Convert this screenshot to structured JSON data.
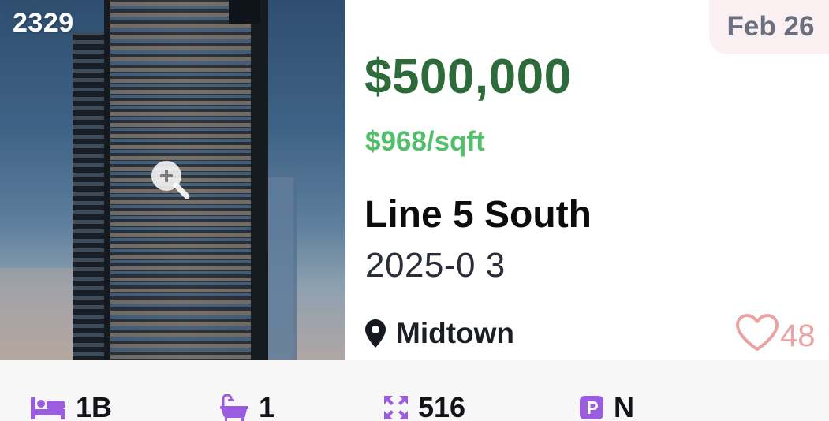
{
  "listing": {
    "id": "2329",
    "date": "Feb 26",
    "price": "$500,000",
    "price_per_sqft": "$968/sqft",
    "project_name": "Line 5 South",
    "occupancy": "2025-0 3",
    "location": "Midtown",
    "favorites_count": "48"
  },
  "stats": {
    "beds": "1B",
    "baths": "1",
    "size": "516",
    "parking": "N"
  },
  "icons": {
    "zoom": "zoom-in-icon",
    "location": "map-pin-icon",
    "favorite": "heart-outline-icon",
    "beds": "bed-icon",
    "baths": "bathtub-icon",
    "size": "expand-arrows-icon",
    "parking": "parking-icon"
  },
  "colors": {
    "price": "#2e6b3a",
    "price_per_sqft": "#52c06a",
    "date_badge_bg": "#fbf0f1",
    "stat_icon": "#9a5de0",
    "heart": "#eaa3a3"
  }
}
